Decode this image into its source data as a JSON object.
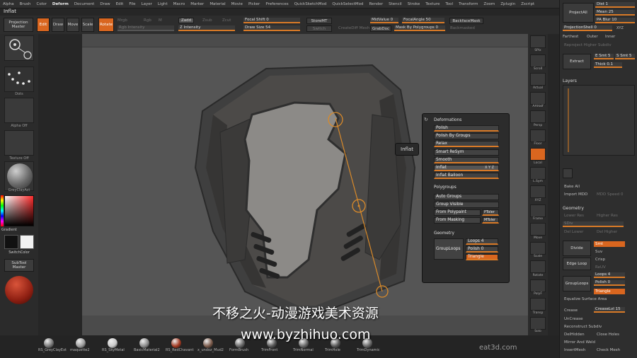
{
  "menu": [
    "Alpha",
    "Brush",
    "Color",
    "Deform",
    "Document",
    "Draw",
    "Edit",
    "File",
    "Layer",
    "Light",
    "Macro",
    "Marker",
    "Material",
    "Movie",
    "Picker",
    "Preferences",
    "QuickSketchMod",
    "QuickSelectMod",
    "Render",
    "Stencil",
    "Stroke",
    "Texture",
    "Tool",
    "Transform",
    "Zoom",
    "Zplugin",
    "Zscript"
  ],
  "menu_active": "Deform",
  "title": "Inflat",
  "shelf": {
    "projection_master": "Projection Master",
    "edit": "Edit",
    "draw": "Draw",
    "move": "Move",
    "scale": "Scale",
    "rotate": "Rotate",
    "mrgb": "Mrgb",
    "rgb": "Rgb",
    "m": "M",
    "zadd": "Zadd",
    "zsub": "Zsub",
    "zcut": "Zcut",
    "rgb_intensity": "Rgb Intensity",
    "z_intensity": "Z Intensity",
    "focal_shift": "Focal Shift 0",
    "draw_size": "Draw Size 54",
    "store_mt": "StoreMT",
    "switch": "Switch",
    "create_dif": "CreateDiff Mesh",
    "midvalue": "MidValue 0",
    "focal_angle": "FocalAngle 50",
    "backface_mask": "BackfaceMask",
    "grab_doc": "GrabDoc",
    "mask_by_polygroups": "Mask By Polygroups 0",
    "backmasked": "Backmasked"
  },
  "left": {
    "captions": [
      "",
      "Dots",
      "Alpha Off",
      "Texture Off",
      "GreyClayAct"
    ],
    "gradient": "Gradient",
    "switch_color": "SwitchColor",
    "subtool_master": "SubTool Master"
  },
  "right_icons": [
    "SPix",
    "Scroll",
    "Actual",
    "AAHalf",
    "Persp",
    "Floor",
    "Local",
    "L.Sym",
    "XYZ",
    "Frame",
    "Move",
    "Scale",
    "Rotate",
    "PolyF",
    "Transp",
    "Solo"
  ],
  "right_panel": {
    "project_all": "ProjectAll",
    "dist": "Dist 1",
    "mean": "Mean 25",
    "pa_blur": "PA Blur 10",
    "projection_shell": "ProjectionShell 0",
    "xyz": "XYZ",
    "farthest": "Farthest",
    "outer": "Outer",
    "inner": "Inner",
    "reproject_higher": "Reproject Higher Subdiv",
    "extract": "Extract",
    "e_smt": "E Smt 5",
    "s_smt": "S Smt 5",
    "thick": "Thick 0.1",
    "layers": "Layers",
    "bake_all": "Bake All",
    "import_mdd": "Import MDD",
    "mdd_speed": "MDD Speed 0",
    "geometry": "Geometry",
    "lower_res": "Lower Res",
    "higher_res": "Higher Res",
    "sdiv": "SDiv",
    "del_lower": "Del Lower",
    "del_higher": "Del Higher",
    "divide": "Divide",
    "smt": "Smt",
    "suv": "Suv",
    "reuv": "ReUV",
    "edge_loop": "Edge Loop",
    "crisp": "Crisp",
    "loops": "Loops 4",
    "group_loops": "GroupLoops",
    "polish": "Polish 0",
    "triangle": "Triangle",
    "equalize": "Equalize Surface Area",
    "crease": "Crease",
    "crease_lvl": "CreaseLvl 15",
    "uncrease": "UnCrease",
    "reconstruct": "Reconstruct Subdiv",
    "delhidden": "DelHidden",
    "close_holes": "Close Holes",
    "mirror_weld": "Mirror And Weld",
    "insert_mesh": "InsertMesh",
    "check_mesh": "Check Mesh"
  },
  "popup": {
    "deformations": "Deformations",
    "items": [
      "Polish",
      "Polish By Groups",
      "Relax",
      "Smart ReSym",
      "Smooth",
      "Inflat",
      "Inflat Balloon"
    ],
    "polygroups": "Polygroups",
    "poly_items": [
      "Auto Groups",
      "Group Visible",
      "From Polypaint",
      "From Masking"
    ],
    "ptoler": "PToler",
    "mtoler": "MToler",
    "geometry": "Geometry",
    "loops": "Loops 4",
    "group_loops": "GroupLoops",
    "polish": "Polish 0",
    "triangle": "Triangle",
    "xyz": "X Y Z"
  },
  "tooltip": "Inflat",
  "materials": [
    "RS_GreyClayExt",
    "maquette2",
    "RS_SkyMetal",
    "BasicMaterial2",
    "RS_RedChavant",
    "x_undoz_Mud2",
    "FormBrush",
    "TrimFront",
    "TrimNormal",
    "TrimHole",
    "TrimDynamic"
  ],
  "watermark_line1": "不移之火-动漫游戏美术资源",
  "watermark_line2": "www.byzhihuo.com",
  "brand": "eat3d.com",
  "colors": {
    "accent": "#d9661f",
    "panel": "#2e2e2e",
    "viewport": "#4b4b4b"
  }
}
